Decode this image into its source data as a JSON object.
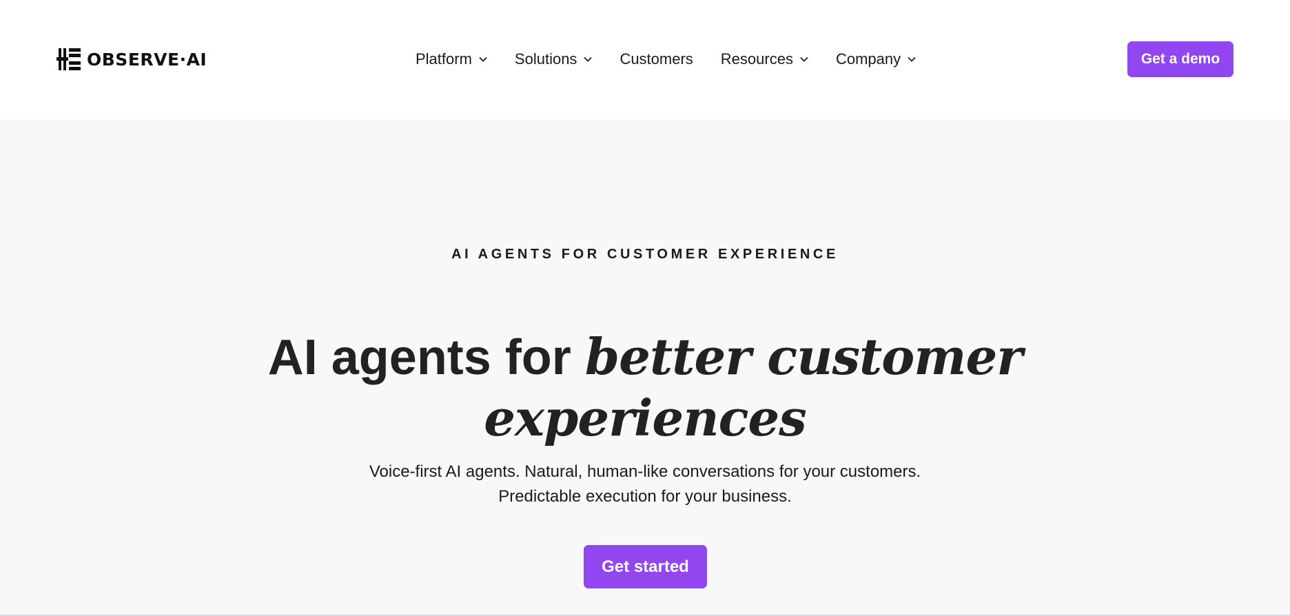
{
  "header": {
    "logo": {
      "text": "OBSERVE·AI",
      "icon": "observe-ai-bars-icon"
    },
    "nav": [
      {
        "label": "Platform",
        "has_dropdown": true
      },
      {
        "label": "Solutions",
        "has_dropdown": true
      },
      {
        "label": "Customers",
        "has_dropdown": false
      },
      {
        "label": "Resources",
        "has_dropdown": true
      },
      {
        "label": "Company",
        "has_dropdown": true
      }
    ],
    "demo_button": "Get a demo"
  },
  "hero": {
    "eyebrow": "AI AGENTS FOR CUSTOMER EXPERIENCE",
    "headline_plain": "AI agents for",
    "headline_italic_1": "better customer",
    "headline_italic_2": "experiences",
    "subtext_line1": "Voice-first AI agents. Natural, human-like conversations for your customers.",
    "subtext_line2": "Predictable execution for your business.",
    "cta_button": "Get started"
  },
  "colors": {
    "accent": "#9146f0",
    "hero_background": "#f8f8fb",
    "text": "#1a1a1a"
  }
}
